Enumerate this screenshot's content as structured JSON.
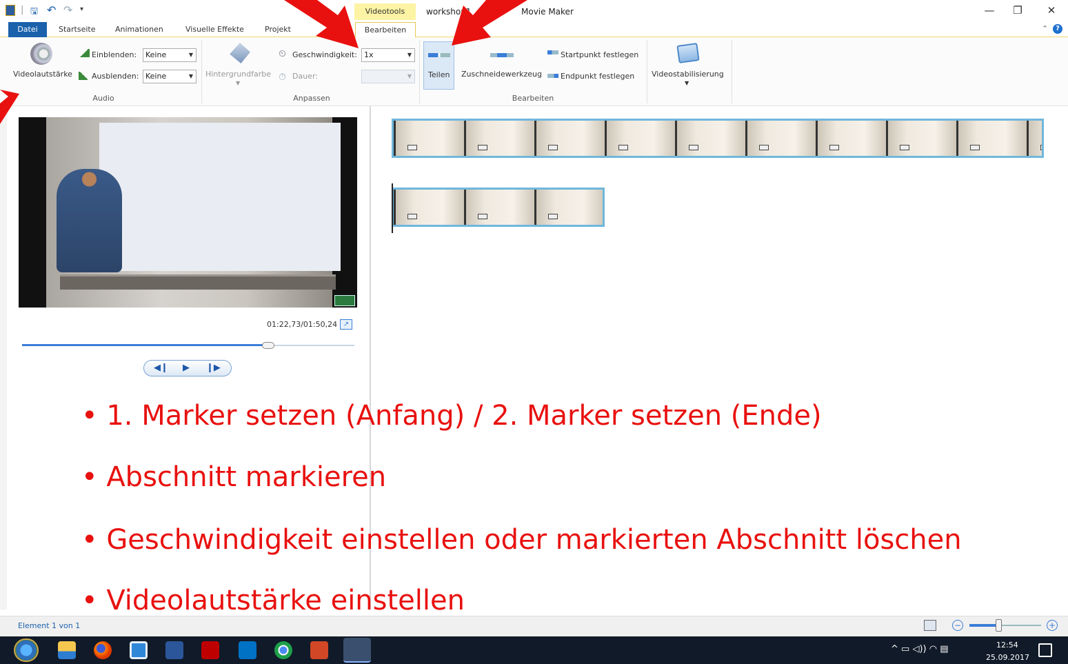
{
  "titlebar": {
    "context_tab": "Videotools",
    "title_left": "workshop1",
    "title_right": "Movie Maker",
    "minimize": "—",
    "restore": "❐",
    "close": "✕"
  },
  "tabs": {
    "datei": "Datei",
    "startseite": "Startseite",
    "animationen": "Animationen",
    "visuelle_effekte": "Visuelle Effekte",
    "projekt": "Projekt",
    "bearbeiten": "Bearbeiten"
  },
  "ribbon": {
    "videolautstaerke": "Videolautstärke",
    "einblenden_label": "Einblenden:",
    "einblenden_value": "Keine",
    "ausblenden_label": "Ausblenden:",
    "ausblenden_value": "Keine",
    "group_audio": "Audio",
    "hintergrundfarbe": "Hintergrundfarbe",
    "geschwindigkeit_label": "Geschwindigkeit:",
    "geschwindigkeit_value": "1x",
    "dauer_label": "Dauer:",
    "group_anpassen": "Anpassen",
    "teilen": "Teilen",
    "zuschneidewerkzeug": "Zuschneidewerkzeug",
    "startpunkt": "Startpunkt festlegen",
    "endpunkt": "Endpunkt festlegen",
    "group_bearbeiten": "Bearbeiten",
    "videostabilisierung": "Videostabilisierung"
  },
  "preview": {
    "time": "01:22,73/01:50,24",
    "progress": 0.74
  },
  "bullets": [
    "1. Marker setzen (Anfang) / 2. Marker setzen (Ende)",
    "Abschnitt markieren",
    "Geschwindigkeit einstellen oder markierten Abschnitt löschen",
    "Videolautstärke einstellen"
  ],
  "status": {
    "element": "Element 1 von 1"
  },
  "taskbar": {
    "time": "12:54",
    "date": "25.09.2017"
  },
  "colors": {
    "accent": "#1b61ac",
    "annotation": "#e8110f",
    "context_tab": "#fcf3a4"
  }
}
